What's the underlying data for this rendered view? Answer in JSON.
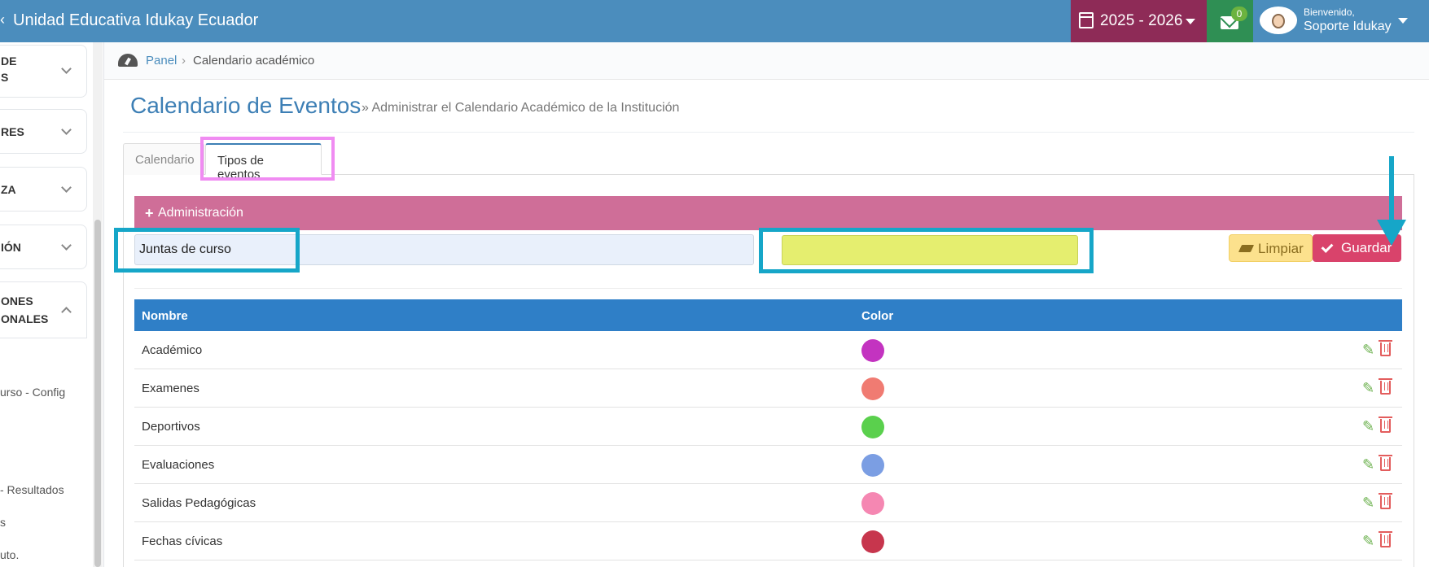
{
  "topbar": {
    "back_glyph": "‹",
    "school_name": "Unidad Educativa Idukay Ecuador",
    "year_label": "2025 - 2026",
    "mail_count": "0",
    "welcome": "Bienvenido,",
    "user_name": "Soporte Idukay"
  },
  "sidebar": {
    "items": [
      {
        "line1": "DE",
        "line2": "S"
      },
      {
        "line1": "RES"
      },
      {
        "line1": "ZA"
      },
      {
        "line1": "IÓN"
      },
      {
        "line1": "ONES",
        "line2": "ONALES"
      }
    ],
    "sub_items": [
      "urso - Config",
      "- Resultados",
      "s",
      "uto."
    ]
  },
  "breadcrumb": {
    "panel": "Panel",
    "separator": "›",
    "current": "Calendario académico"
  },
  "page": {
    "title": "Calendario de Eventos",
    "subtitle": "» Administrar el Calendario Académico de la Institución"
  },
  "tabs": [
    {
      "label": "Calendario",
      "active": false
    },
    {
      "label": "Tipos de eventos",
      "active": true
    }
  ],
  "admin": {
    "plus": "+",
    "label": "Administración",
    "name_value": "Juntas de curso",
    "color_value": "#e5ee6f",
    "clear_label": "Limpiar",
    "save_label": "Guardar"
  },
  "table": {
    "headers": [
      "Nombre",
      "Color"
    ],
    "rows": [
      {
        "name": "Académico",
        "color": "#c333c0"
      },
      {
        "name": "Examenes",
        "color": "#f07b72"
      },
      {
        "name": "Deportivos",
        "color": "#5ad04d"
      },
      {
        "name": "Evaluaciones",
        "color": "#7b9ee3"
      },
      {
        "name": "Salidas Pedagógicas",
        "color": "#f587b2"
      },
      {
        "name": "Fechas cívicas",
        "color": "#c7364d"
      }
    ]
  },
  "colors": {
    "topbar": "#4b8dbd",
    "year_badge": "#8e2b57",
    "mail_badge": "#2f8f54",
    "admin_bar": "#cf6e98",
    "table_header": "#2f7fc7",
    "save_button": "#d9436b",
    "clear_button": "#fce18d",
    "annotation_cyan": "#16a6c8",
    "annotation_pink": "#f08cf2"
  }
}
